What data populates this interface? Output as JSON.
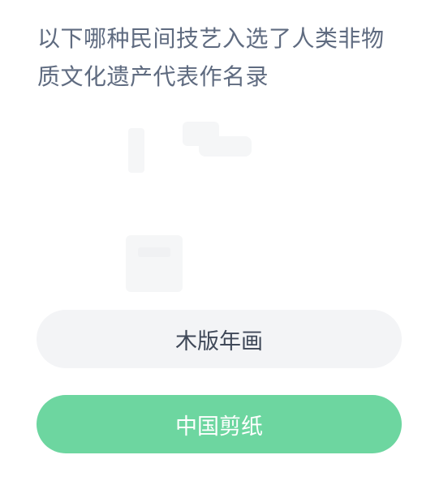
{
  "question": {
    "text": "以下哪种民间技艺入选了人类非物质文化遗产代表作名录"
  },
  "options": [
    {
      "label": "木版年画",
      "state": "default"
    },
    {
      "label": "中国剪纸",
      "state": "selected"
    }
  ],
  "colors": {
    "question_text": "#5f6b80",
    "option_bg": "#f3f4f6",
    "option_text": "#3f4858",
    "selected_bg": "#6dd6a0",
    "selected_text": "#ffffff"
  }
}
